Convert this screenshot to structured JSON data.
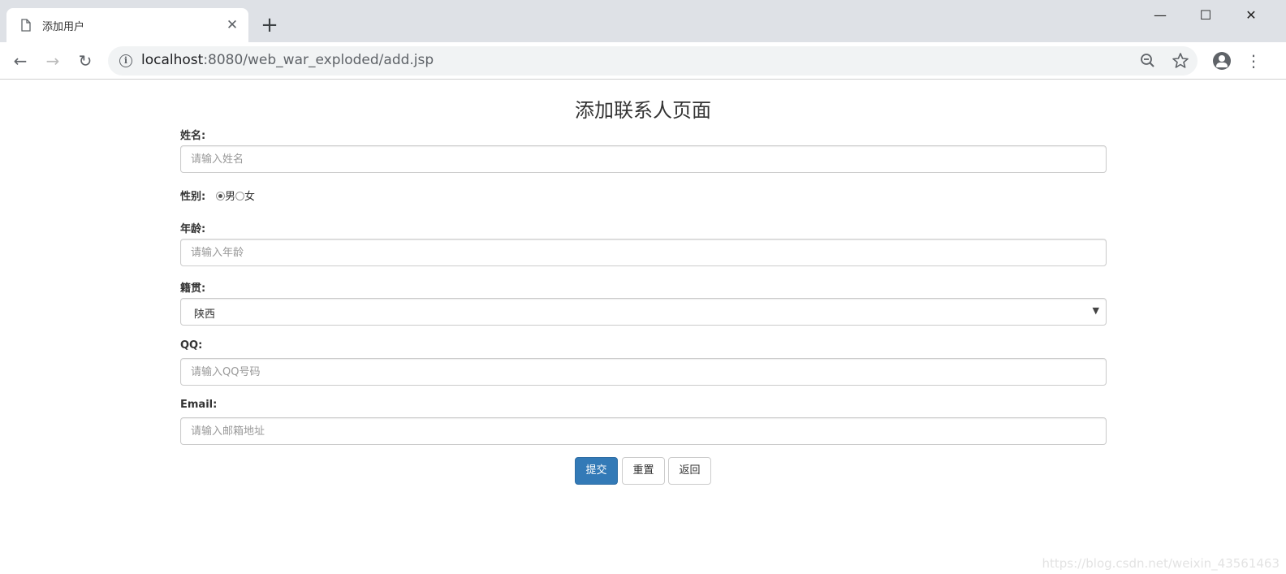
{
  "browser": {
    "tab_title": "添加用户",
    "tab_close": "✕",
    "new_tab": "+",
    "url_host": "localhost",
    "url_rest": ":8080/web_war_exploded/add.jsp",
    "window_controls": {
      "minimize": "—",
      "maximize": "☐",
      "close": "✕"
    },
    "nav": {
      "back": "←",
      "forward": "→",
      "reload": "↻"
    },
    "icons": [
      "page-icon",
      "info-icon",
      "zoom-out-icon",
      "star-icon",
      "profile-icon",
      "menu-icon"
    ]
  },
  "page": {
    "title": "添加联系人页面",
    "fields": {
      "name": {
        "label": "姓名:",
        "placeholder": "请输入姓名"
      },
      "gender": {
        "label": "性别:",
        "options": [
          "男",
          "女"
        ],
        "selected": "男"
      },
      "age": {
        "label": "年龄:",
        "placeholder": "请输入年龄"
      },
      "hometown": {
        "label": "籍贯:",
        "selected": "陕西"
      },
      "qq": {
        "label": "QQ:",
        "placeholder": "请输入QQ号码"
      },
      "email": {
        "label": "Email:",
        "placeholder": "请输入邮箱地址"
      }
    },
    "buttons": {
      "submit": "提交",
      "reset": "重置",
      "back": "返回"
    },
    "primary_color": "#337ab7"
  },
  "watermark": "https://blog.csdn.net/weixin_43561463"
}
